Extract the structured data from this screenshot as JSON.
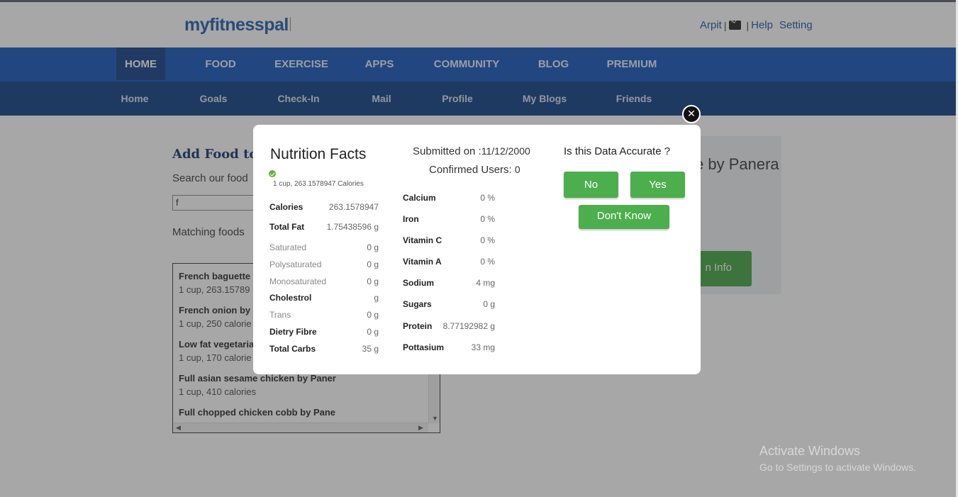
{
  "header": {
    "logo": "myfitnesspal",
    "user_name": "Arpit",
    "separator": "|",
    "help": "Help",
    "setting": "Setting",
    "mail_icon": "envelope-icon"
  },
  "nav_main": [
    "HOME",
    "FOOD",
    "EXERCISE",
    "APPS",
    "COMMUNITY",
    "BLOG",
    "PREMIUM"
  ],
  "nav_sub": [
    "Home",
    "Goals",
    "Check-In",
    "Mail",
    "Profile",
    "My Blogs",
    "Friends"
  ],
  "background_page": {
    "title": "Add Food to",
    "search_label": "Search our food",
    "search_value": "f",
    "matching_label": "Matching foods",
    "results": [
      {
        "name": "French baguette",
        "meta": "1 cup, 263.15789"
      },
      {
        "name": "French onion by F",
        "meta": "1 cup, 250 calorie"
      },
      {
        "name": "Low fat vegetaria",
        "meta": "1 cup, 170 calorie"
      },
      {
        "name": "Full asian sesame chicken by Paner",
        "meta": "1 cup, 410 calories"
      },
      {
        "name": "Full chopped chicken cobb by Pane",
        "meta": ""
      }
    ],
    "right_title": "e by Panera",
    "right_button": "n Info"
  },
  "modal": {
    "title": "Nutrition Facts",
    "serving": "1 cup, 263.1578947 Calories",
    "left_rows": [
      {
        "label": "Calories",
        "value": "263.1578947",
        "bold": true
      },
      {
        "label": "Total Fat",
        "value": "1.75438596 g",
        "bold": true
      },
      {
        "label": "Saturated",
        "value": "0 g",
        "bold": false
      },
      {
        "label": "Polysaturated",
        "value": "0 g",
        "bold": false
      },
      {
        "label": "Monosaturated",
        "value": "0 g",
        "bold": false
      },
      {
        "label": "Cholestrol",
        "value": "g",
        "bold": true
      },
      {
        "label": "Trans",
        "value": "0 g",
        "bold": false
      },
      {
        "label": "Dietry Fibre",
        "value": "0 g",
        "bold": true
      },
      {
        "label": "Total Carbs",
        "value": "35 g",
        "bold": true
      }
    ],
    "submitted_label": "Submitted on :",
    "submitted_date": "11/12/2000",
    "confirmed_label": "Confirmed Users:",
    "confirmed_count": "0",
    "mid_rows": [
      {
        "label": "Calcium",
        "value": "0 %"
      },
      {
        "label": "Iron",
        "value": "0 %"
      },
      {
        "label": "Vitamin C",
        "value": "0 %"
      },
      {
        "label": "Vitamin A",
        "value": "0 %"
      },
      {
        "label": "Sodium",
        "value": "4 mg"
      },
      {
        "label": "Sugars",
        "value": "0 g"
      },
      {
        "label": "Protein",
        "value": "8.77192982 g"
      },
      {
        "label": "Pottasium",
        "value": "33 mg"
      }
    ],
    "question": "Is this Data Accurate ?",
    "no_label": "No",
    "yes_label": "Yes",
    "dont_know_label": "Don't Know",
    "close_symbol": "✕"
  },
  "watermark": {
    "line1": "Activate Windows",
    "line2": "Go to Settings to activate Windows."
  },
  "colors": {
    "nav_main": "#0d4fb8",
    "nav_sub": "#093a80",
    "button_green": "#4cae4c"
  }
}
